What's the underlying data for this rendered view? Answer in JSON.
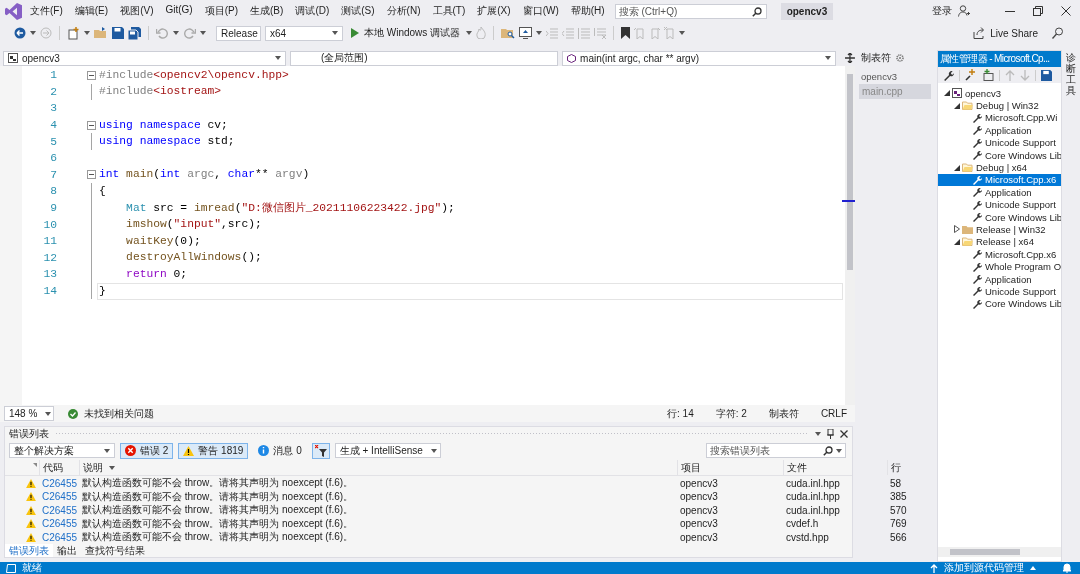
{
  "menu": {
    "items": [
      "文件(F)",
      "编辑(E)",
      "视图(V)",
      "Git(G)",
      "项目(P)",
      "生成(B)",
      "调试(D)",
      "测试(S)",
      "分析(N)",
      "工具(T)",
      "扩展(X)",
      "窗口(W)",
      "帮助(H)"
    ]
  },
  "search": {
    "placeholder": "搜索 (Ctrl+Q)"
  },
  "solution_title": "opencv3",
  "sign_in": "登录",
  "toolbar": {
    "configuration": "Release",
    "platform": "x64",
    "debugger": "本地 Windows 调试器",
    "live_share": "Live Share"
  },
  "editor": {
    "nav": {
      "project": "opencv3",
      "scope": "(全局范围)",
      "member": "main(int argc, char ** argv)"
    },
    "lines": [
      {
        "number": "1",
        "collapsible": true,
        "current": false,
        "tokens": [
          {
            "text": "#include",
            "kind": "preproc"
          },
          {
            "text": "<opencv2\\opencv.hpp>",
            "kind": "string"
          }
        ]
      },
      {
        "number": "2",
        "collapsible": false,
        "current": false,
        "tokens": [
          {
            "text": "#include",
            "kind": "preproc"
          },
          {
            "text": "<iostream>",
            "kind": "string"
          }
        ]
      },
      {
        "number": "3",
        "collapsible": false,
        "current": false
      },
      {
        "number": "4",
        "collapsible": true,
        "current": false,
        "tokens": [
          {
            "text": "using",
            "kind": "keyword"
          },
          {
            "text": " namespace",
            "kind": "keyword"
          },
          {
            "text": " cv;",
            "kind": "plain"
          }
        ]
      },
      {
        "number": "5",
        "collapsible": false,
        "current": false,
        "tokens": [
          {
            "text": "using",
            "kind": "keyword"
          },
          {
            "text": " namespace",
            "kind": "keyword"
          },
          {
            "text": " std;",
            "kind": "plain"
          }
        ]
      },
      {
        "number": "6",
        "collapsible": false,
        "current": false
      },
      {
        "number": "7",
        "collapsible": true,
        "current": false,
        "tokens": [
          {
            "text": "int",
            "kind": "keyword"
          },
          {
            "text": " main",
            "kind": "func"
          },
          {
            "text": "(",
            "kind": "plain"
          },
          {
            "text": "int",
            "kind": "keyword"
          },
          {
            "text": " argc",
            "kind": "param"
          },
          {
            "text": ", ",
            "kind": "plain"
          },
          {
            "text": "char",
            "kind": "keyword"
          },
          {
            "text": "**",
            "kind": "plain"
          },
          {
            "text": " argv",
            "kind": "param"
          },
          {
            "text": ")",
            "kind": "plain"
          }
        ]
      },
      {
        "number": "8",
        "collapsible": false,
        "current": false,
        "tokens": [
          {
            "text": "{",
            "kind": "plain"
          }
        ]
      },
      {
        "number": "9",
        "collapsible": false,
        "current": false,
        "tokens": [
          {
            "text": "    Mat",
            "kind": "type"
          },
          {
            "text": " src = ",
            "kind": "plain"
          },
          {
            "text": "imread",
            "kind": "func"
          },
          {
            "text": "(",
            "kind": "plain"
          },
          {
            "text": "\"D:微信图片_20211106223422.jpg\"",
            "kind": "string"
          },
          {
            "text": ");",
            "kind": "plain"
          }
        ]
      },
      {
        "number": "10",
        "collapsible": false,
        "current": false,
        "tokens": [
          {
            "text": "    imshow",
            "kind": "func"
          },
          {
            "text": "(",
            "kind": "plain"
          },
          {
            "text": "\"input\"",
            "kind": "string"
          },
          {
            "text": ",src);",
            "kind": "plain"
          }
        ]
      },
      {
        "number": "11",
        "collapsible": false,
        "current": false,
        "tokens": [
          {
            "text": "    waitKey",
            "kind": "func"
          },
          {
            "text": "(0);",
            "kind": "plain"
          }
        ]
      },
      {
        "number": "12",
        "collapsible": false,
        "current": false,
        "tokens": [
          {
            "text": "    destroyAllWindows",
            "kind": "func"
          },
          {
            "text": "();",
            "kind": "plain"
          }
        ]
      },
      {
        "number": "13",
        "collapsible": false,
        "current": false,
        "tokens": [
          {
            "text": "    return",
            "kind": "control"
          },
          {
            "text": " 0;",
            "kind": "plain"
          }
        ]
      },
      {
        "number": "14",
        "collapsible": false,
        "current": true,
        "tokens": [
          {
            "text": "}",
            "kind": "plain"
          }
        ]
      }
    ],
    "zoom": "148 %",
    "health": "未找到相关问题",
    "line_info": "行: 14",
    "char_info": "字符: 2",
    "indent": "制表符",
    "eol": "CRLF"
  },
  "tab_well": {
    "title": "制表符",
    "group": "opencv3",
    "files": [
      {
        "label": "main.cpp",
        "selected": true
      }
    ]
  },
  "property_manager": {
    "title": "属性管理器 - Microsoft.Cp...",
    "tree": [
      {
        "label": "opencv3",
        "kind": "project",
        "expanded": true,
        "selected": false,
        "children": [
          {
            "label": "Debug | Win32",
            "kind": "config",
            "expanded": true,
            "selected": false,
            "children": [
              {
                "label": "Microsoft.Cpp.Wi",
                "kind": "sheet",
                "selected": false
              },
              {
                "label": "Application",
                "kind": "sheet",
                "selected": false
              },
              {
                "label": "Unicode Support",
                "kind": "sheet",
                "selected": false
              },
              {
                "label": "Core Windows Lib",
                "kind": "sheet",
                "selected": false
              }
            ]
          },
          {
            "label": "Debug | x64",
            "kind": "config",
            "expanded": true,
            "selected": false,
            "children": [
              {
                "label": "Microsoft.Cpp.x6",
                "kind": "sheet",
                "selected": true
              },
              {
                "label": "Application",
                "kind": "sheet",
                "selected": false
              },
              {
                "label": "Unicode Support",
                "kind": "sheet",
                "selected": false
              },
              {
                "label": "Core Windows Lib",
                "kind": "sheet",
                "selected": false
              }
            ]
          },
          {
            "label": "Release | Win32",
            "kind": "config",
            "expanded": false,
            "selected": false
          },
          {
            "label": "Release | x64",
            "kind": "config",
            "expanded": true,
            "selected": false,
            "children": [
              {
                "label": "Microsoft.Cpp.x6",
                "kind": "sheet",
                "selected": false
              },
              {
                "label": "Whole Program O",
                "kind": "sheet",
                "selected": false
              },
              {
                "label": "Application",
                "kind": "sheet",
                "selected": false
              },
              {
                "label": "Unicode Support",
                "kind": "sheet",
                "selected": false
              },
              {
                "label": "Core Windows Lib",
                "kind": "sheet",
                "selected": false
              }
            ]
          }
        ]
      }
    ]
  },
  "side_tab": "诊断工具",
  "error_list": {
    "title": "错误列表",
    "scope": "整个解决方案",
    "filters": [
      {
        "kind": "error",
        "label": "错误 2",
        "selected": true
      },
      {
        "kind": "warning",
        "label": "警告 1819",
        "selected": true
      },
      {
        "kind": "message",
        "label": "消息 0",
        "selected": false
      }
    ],
    "build_filter": "生成 + IntelliSense",
    "search_placeholder": "搜索错误列表",
    "columns": [
      "代码",
      "说明",
      "项目",
      "文件",
      "行"
    ],
    "rows": [
      {
        "kind": "warning",
        "code": "C26455",
        "description": "默认构造函数可能不会 throw。请将其声明为 noexcept (f.6)。",
        "project": "opencv3",
        "file": "cuda.inl.hpp",
        "line": "58"
      },
      {
        "kind": "warning",
        "code": "C26455",
        "description": "默认构造函数可能不会 throw。请将其声明为 noexcept (f.6)。",
        "project": "opencv3",
        "file": "cuda.inl.hpp",
        "line": "385"
      },
      {
        "kind": "warning",
        "code": "C26455",
        "description": "默认构造函数可能不会 throw。请将其声明为 noexcept (f.6)。",
        "project": "opencv3",
        "file": "cuda.inl.hpp",
        "line": "570"
      },
      {
        "kind": "warning",
        "code": "C26455",
        "description": "默认构造函数可能不会 throw。请将其声明为 noexcept (f.6)。",
        "project": "opencv3",
        "file": "cvdef.h",
        "line": "769"
      },
      {
        "kind": "warning",
        "code": "C26455",
        "description": "默认构造函数可能不会 throw。请将其声明为 noexcept (f.6)。",
        "project": "opencv3",
        "file": "cvstd.hpp",
        "line": "566"
      }
    ]
  },
  "bottom_tabs": [
    {
      "label": "错误列表",
      "selected": true
    },
    {
      "label": "输出",
      "selected": false
    },
    {
      "label": "查找符号结果",
      "selected": false
    }
  ],
  "status_bar": {
    "text": "就绪",
    "source_control": "添加到源代码管理"
  }
}
